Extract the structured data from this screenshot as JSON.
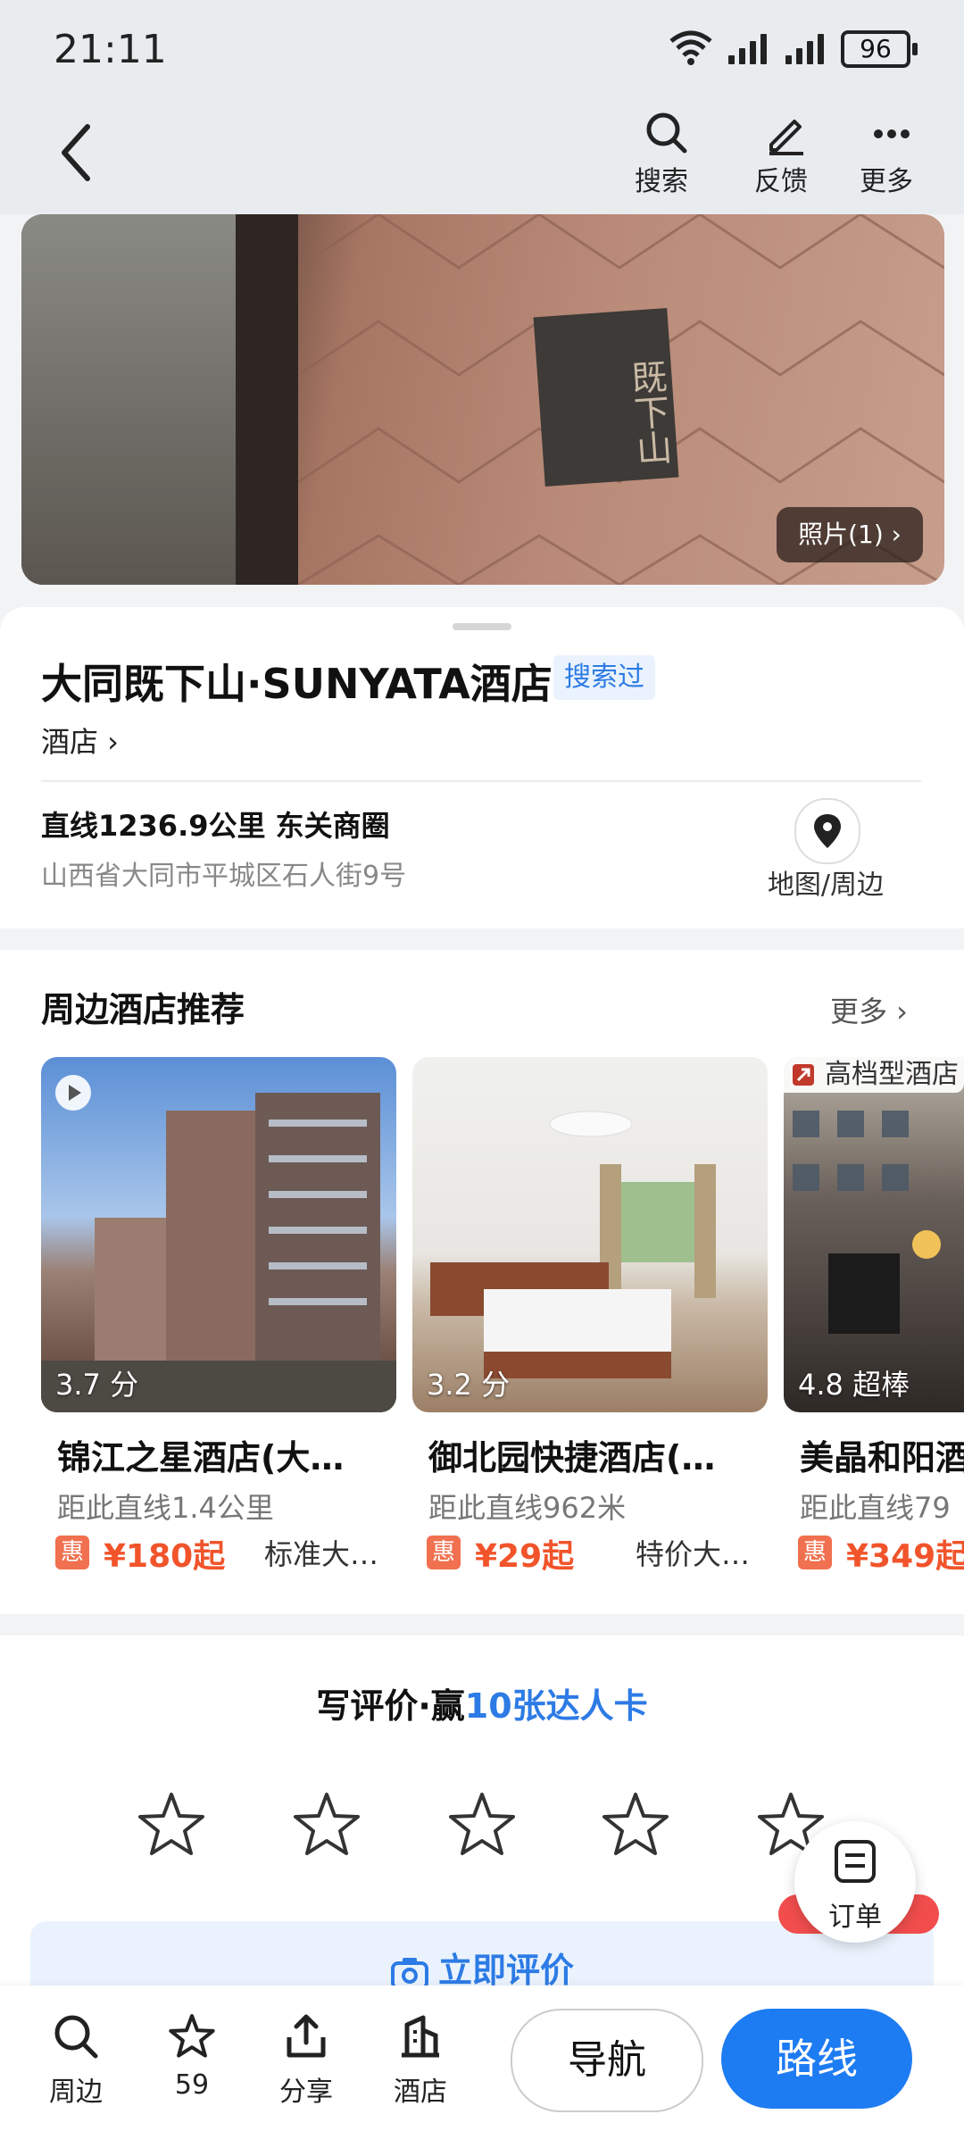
{
  "status_bar": {
    "time": "21:11",
    "battery": "96"
  },
  "header": {
    "search": "搜索",
    "feedback": "反馈",
    "more": "更多"
  },
  "photo": {
    "count_label": "照片(1) ›",
    "plaque_text": "既下山"
  },
  "poi": {
    "name": "大同既下山·SUNYATA酒店",
    "searched_tag": "搜索过",
    "category": "酒店 ›",
    "distance_line": "直线1236.9公里 东关商圈",
    "address": "山西省大同市平城区石人街9号",
    "map_label": "地图/周边"
  },
  "nearby": {
    "title": "周边酒店推荐",
    "more": "更多 ›",
    "hotels": [
      {
        "score": "3.7 分",
        "name": "锦江之星酒店(大…",
        "distance": "距此直线1.4公里",
        "badge": "惠",
        "price": "¥180起",
        "extra": "标准大…"
      },
      {
        "score": "3.2 分",
        "name": "御北园快捷酒店(…",
        "distance": "距此直线962米",
        "badge": "惠",
        "price": "¥29起",
        "extra": "特价大…"
      },
      {
        "score": "4.8 超棒",
        "name": "美晶和阳酒",
        "distance": "距此直线79",
        "badge": "惠",
        "price": "¥349起",
        "extra": "",
        "grade": "高档型酒店"
      }
    ]
  },
  "review": {
    "title_prefix": "写评价·赢",
    "title_highlight": "10张达人卡",
    "button": "立即评价",
    "order": "订单"
  },
  "bottom_bar": {
    "nearby": "周边",
    "favorites": "59",
    "share": "分享",
    "hotel": "酒店",
    "navigate": "导航",
    "route": "路线"
  },
  "colors": {
    "accent": "#2d7be5",
    "price": "#f1542b",
    "route_button": "#1e7cf2"
  }
}
